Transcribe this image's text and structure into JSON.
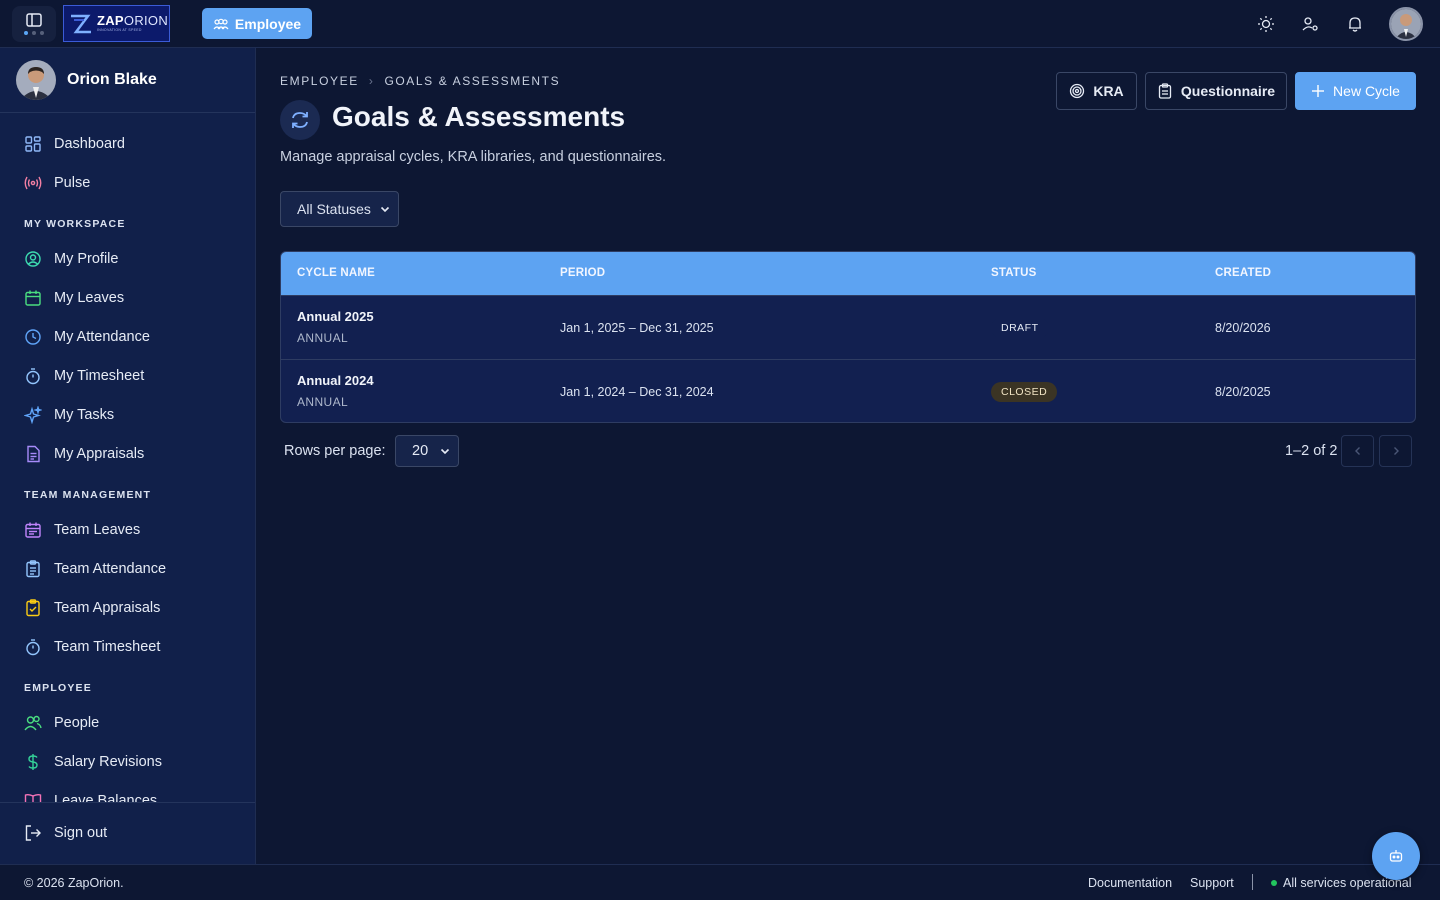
{
  "topbar": {
    "logo_name_bold": "ZAP",
    "logo_name_rest": "ORION",
    "logo_tagline": "INNOVATION AT SPEED",
    "role_label": "Employee"
  },
  "user": {
    "name": "Orion Blake"
  },
  "sidebar": {
    "items_top": [
      {
        "label": "Dashboard",
        "icon": "grid-icon"
      },
      {
        "label": "Pulse",
        "icon": "broadcast-icon"
      }
    ],
    "sections": [
      {
        "title": "MY WORKSPACE",
        "items": [
          {
            "label": "My Profile",
            "icon": "user-circle-icon"
          },
          {
            "label": "My Leaves",
            "icon": "calendar-icon"
          },
          {
            "label": "My Attendance",
            "icon": "clock-icon"
          },
          {
            "label": "My Timesheet",
            "icon": "stopwatch-icon"
          },
          {
            "label": "My Tasks",
            "icon": "sparkle-icon"
          },
          {
            "label": "My Appraisals",
            "icon": "document-icon"
          }
        ]
      },
      {
        "title": "TEAM MANAGEMENT",
        "items": [
          {
            "label": "Team Leaves",
            "icon": "calendar-icon"
          },
          {
            "label": "Team Attendance",
            "icon": "clipboard-icon"
          },
          {
            "label": "Team Appraisals",
            "icon": "clipboard-check-icon"
          },
          {
            "label": "Team Timesheet",
            "icon": "stopwatch-icon"
          }
        ]
      },
      {
        "title": "EMPLOYEE",
        "items": [
          {
            "label": "People",
            "icon": "users-icon"
          },
          {
            "label": "Salary Revisions",
            "icon": "dollar-icon"
          },
          {
            "label": "Leave Balances",
            "icon": "book-icon"
          }
        ]
      }
    ],
    "signout_label": "Sign out"
  },
  "main": {
    "breadcrumb": [
      "EMPLOYEE",
      "GOALS & ASSESSMENTS"
    ],
    "breadcrumb_sep": "›",
    "title": "Goals & Assessments",
    "subtitle": "Manage appraisal cycles, KRA libraries, and questionnaires.",
    "buttons": {
      "kra": "KRA",
      "questionnaire": "Questionnaire",
      "new_cycle": "New Cycle"
    },
    "status_filter": "All Statuses",
    "table": {
      "columns": [
        "CYCLE NAME",
        "PERIOD",
        "STATUS",
        "CREATED"
      ],
      "rows": [
        {
          "name": "Annual 2025",
          "type": "ANNUAL",
          "period": "Jan 1, 2025 – Dec 31, 2025",
          "status": "DRAFT",
          "created": "8/20/2026"
        },
        {
          "name": "Annual 2024",
          "type": "ANNUAL",
          "period": "Jan 1, 2024 – Dec 31, 2024",
          "status": "CLOSED",
          "created": "8/20/2025"
        }
      ]
    },
    "pagination": {
      "rows_label": "Rows per page:",
      "rows_value": "20",
      "range": "1–2 of 2"
    }
  },
  "footer": {
    "copyright": "© 2026 ZapOrion.",
    "documentation": "Documentation",
    "support": "Support",
    "status": "All services operational"
  },
  "colors": {
    "accent": "#5da3f2",
    "background": "#0d1733",
    "sidebar": "#11204a",
    "status_ok": "#22c55e"
  }
}
